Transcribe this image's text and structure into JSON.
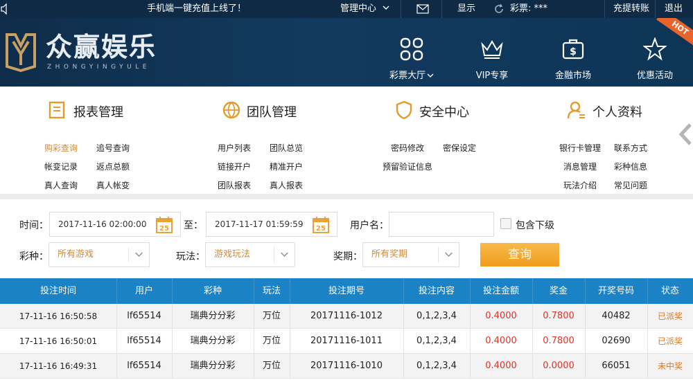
{
  "topbar": {
    "promo": "手机端一键充值上线了！",
    "management_center": "管理中心",
    "show": "显示",
    "lottery_balance": "彩票: ***",
    "deposit_withdraw": "充提转账",
    "logout": "退出"
  },
  "header": {
    "brand": "众赢娱乐",
    "brand_sub": "ZHONGYINGYULE",
    "nav": [
      {
        "label": "彩票大厅",
        "icon": "grid-icon"
      },
      {
        "label": "VIP专享",
        "icon": "crown-icon"
      },
      {
        "label": "金融市场",
        "icon": "money-bag-icon"
      },
      {
        "label": "优惠活动",
        "icon": "star-icon"
      }
    ],
    "hot_badge": "HOT"
  },
  "menu": {
    "groups": [
      {
        "title": "报表管理",
        "icon": "report-icon",
        "links": [
          "购彩查询",
          "追号查询",
          "帐变记录",
          "返点总额",
          "真人查询",
          "真人帐变"
        ]
      },
      {
        "title": "团队管理",
        "icon": "globe-icon",
        "links": [
          "用户列表",
          "团队总览",
          "链接开户",
          "精准开户",
          "团队报表",
          "真人报表"
        ]
      },
      {
        "title": "安全中心",
        "icon": "shield-icon",
        "links": [
          "密码修改",
          "密保设定",
          "预留验证信息"
        ]
      },
      {
        "title": "个人资料",
        "icon": "user-icon",
        "links": [
          "银行卡管理",
          "联系方式",
          "消息管理",
          "彩种信息",
          "玩法介绍",
          "常见问题"
        ]
      }
    ]
  },
  "filter": {
    "time_label": "时间：",
    "start_time": "2017-11-16 02:00:00",
    "to_label": "至：",
    "end_time": "2017-11-17 01:59:59",
    "calendar_day": "25",
    "username_label": "用户名：",
    "username_value": "",
    "include_sub_label": "包含下级",
    "lottery_label": "彩种：",
    "lottery_value": "所有游戏",
    "play_label": "玩法：",
    "play_value": "游戏玩法",
    "period_label": "奖期：",
    "period_value": "所有奖期",
    "query_button": "查询"
  },
  "table": {
    "headers": [
      "投注时间",
      "用户",
      "彩种",
      "玩法",
      "投注期号",
      "投注内容",
      "投注金额",
      "奖金",
      "开奖号码",
      "状态"
    ],
    "rows": [
      [
        "17-11-16 16:50:58",
        "lf65514",
        "瑞典分分彩",
        "万位",
        "20171116-1012",
        "0,1,2,3,4",
        "0.4000",
        "0.7800",
        "40482",
        "已派奖"
      ],
      [
        "17-11-16 16:50:01",
        "lf65514",
        "瑞典分分彩",
        "万位",
        "20171116-1011",
        "0,1,2,3,4",
        "0.4000",
        "0.7800",
        "02690",
        "已派奖"
      ],
      [
        "17-11-16 16:49:31",
        "lf65514",
        "瑞典分分彩",
        "万位",
        "20171116-1010",
        "0,1,2,3,4",
        "0.4000",
        "0.0000",
        "66051",
        "未中奖"
      ]
    ]
  },
  "colors": {
    "accent": "#d08a3c",
    "table_header": "#1b83c5",
    "amount_red": "#e0302a",
    "status_orange": "#e0761f",
    "topbar_bg": "#0e2a44"
  }
}
